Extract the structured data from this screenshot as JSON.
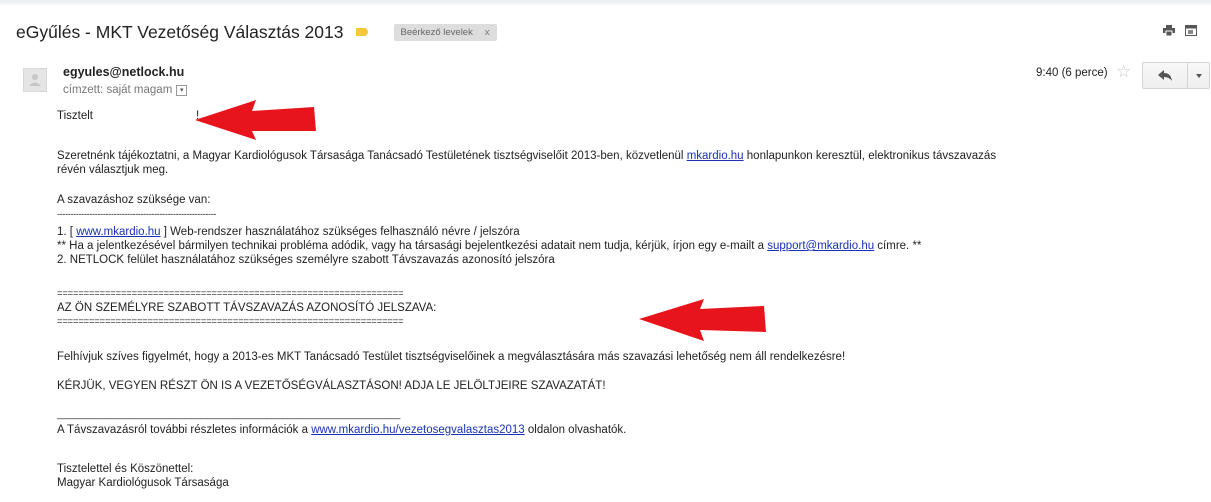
{
  "header": {
    "subject": "eGyűlés - MKT Vezetőség Választás 2013",
    "label": "Beérkező levelek",
    "label_remove": "x",
    "icons": [
      "importance-marker",
      "print-icon",
      "new-window-icon"
    ]
  },
  "message": {
    "sender": "egyules@netlock.hu",
    "recipient": "címzett: saját magam",
    "time": "9:40 (6 perce)",
    "icons": [
      "avatar-icon",
      "star-icon",
      "reply-icon",
      "more-caret-icon"
    ]
  },
  "body": {
    "greeting_a": "Tisztelt",
    "greeting_b": "!",
    "p1_a": "Szeretnénk tájékoztatni, a Magyar Kardiológusok Társasága Tanácsadó Testületének tisztségviselőit 2013-ben, közvetlenül ",
    "p1_link": "mkardio.hu",
    "p1_b": " honlapunkon keresztül, elektronikus távszavazás",
    "p1_c": "révén választjuk meg.",
    "req_title": "A szavazáshoz szüksége van:",
    "dash_line": "-----------------------------------------------------------",
    "item1_a": "1. [ ",
    "item1_link": "www.mkardio.hu",
    "item1_b": " ] Web-rendszer használatához szükséges felhasználó névre / jelszóra",
    "note_a": "** Ha a jelentkezésével bármilyen technikai probléma adódik, vagy ha társasági bejelentkezési adatait nem tudja, kérjük, írjon egy e-mailt a ",
    "note_link": "support@mkardio.hu",
    "note_b": " címre. **",
    "item2": "2. NETLOCK felület használatához szükséges személyre szabott Távszavazás azonosító jelszóra",
    "eq_line": "=================================================================",
    "code_label": "AZ ÖN SZEMÉLYRE SZABOTT TÁVSZAVAZÁS AZONOSÍTÓ JELSZAVA:",
    "notice": "Felhívjuk szíves figyelmét, hogy a 2013-es MKT Tanácsadó Testület tisztségviselőinek a megválasztására más szavazási lehetőség nem áll rendelkezésre!",
    "call": "KÉRJÜK, VEGYEN RÉSZT ÖN IS A VEZETŐSÉGVÁLASZTÁSON! ADJA LE JELÖLTJEIRE SZAVAZATÁT!",
    "under_line": "________________________________________________________________",
    "info_a": "A Távszavazásról további részletes információk a ",
    "info_link": "www.mkardio.hu/vezetosegvalasztas2013",
    "info_b": " oldalon olvashatók.",
    "closing": "Tisztelettel és Köszönettel:",
    "org": "Magyar Kardiológusok Társasága"
  },
  "colors": {
    "arrow": "#e8141c",
    "link": "#1a31b8",
    "importance": "#f5c73a"
  }
}
